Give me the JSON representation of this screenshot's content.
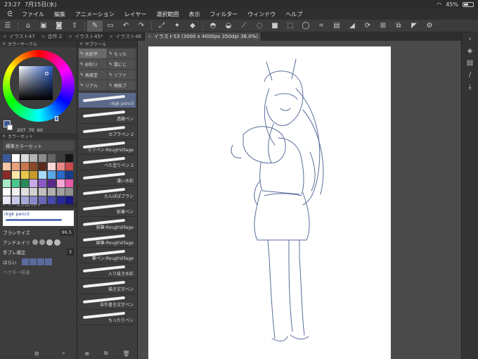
{
  "status": {
    "time": "23:27",
    "date": "7月15日(水)",
    "battery": "45%"
  },
  "menu": [
    "ファイル",
    "編集",
    "アニメーション",
    "レイヤー",
    "選択範囲",
    "表示",
    "フィルター",
    "ウィンドウ",
    "ヘルプ"
  ],
  "tabs": [
    {
      "label": "イラスト47",
      "active": false
    },
    {
      "label": "合作 2",
      "active": false
    },
    {
      "label": "イラスト45*",
      "active": false
    },
    {
      "label": "イラスト48",
      "active": false
    },
    {
      "label": "イラスト53 (3000 x 4000px 350dpi 38.0%)",
      "active": true
    }
  ],
  "panels": {
    "color_circle": "カラーサークル",
    "color_set": "カラーセット",
    "color_set_select": "標準カラーセット",
    "tool_property": "ツールプロパティ",
    "sub_tool": "サブツール"
  },
  "hsv": {
    "h": "207",
    "s": "70",
    "v": "60"
  },
  "tool_props": {
    "preset": "rkgk pencil",
    "brush_size_label": "ブラシサイズ",
    "brush_size_value": "96.5",
    "antialias_label": "アンチエイリ",
    "stabilization_label": "手ブレ補正",
    "stabilization_value": "3",
    "pressure_label": "はらい",
    "vector_label": "ベクター吸着"
  },
  "subtool_tabs": [
    {
      "label": "水彩平",
      "active": true
    },
    {
      "label": "もった",
      "active": false
    },
    {
      "label": "砂利リ",
      "active": false
    },
    {
      "label": "雲にじ",
      "active": false
    },
    {
      "label": "高度塗",
      "active": false
    },
    {
      "label": "ソファ",
      "active": false
    },
    {
      "label": "リアル",
      "active": false
    },
    {
      "label": "梅枝ブ",
      "active": false
    }
  ],
  "brushes": [
    {
      "label": "rkgk pencil",
      "selected": true
    },
    {
      "label": "透鏡ペン",
      "selected": false
    },
    {
      "label": "カブラペン 2",
      "selected": false
    },
    {
      "label": "ミリペン-RoughVillage",
      "selected": false
    },
    {
      "label": "べた塗りペン 2",
      "selected": false
    },
    {
      "label": "濃い水彩",
      "selected": false
    },
    {
      "label": "たんぽぽブラシ",
      "selected": false
    },
    {
      "label": "影筆ペン",
      "selected": false
    },
    {
      "label": "鉛筆-RoughVillage",
      "selected": false
    },
    {
      "label": "線筆-RoughVillage",
      "selected": false
    },
    {
      "label": "筆ペン-RoughVillage",
      "selected": false
    },
    {
      "label": "入り抜き水彩",
      "selected": false
    },
    {
      "label": "描き文字ペン",
      "selected": false
    },
    {
      "label": "自作書き文字ペン",
      "selected": false
    },
    {
      "label": "もったりペン",
      "selected": false
    }
  ],
  "swatches": [
    "#3a5a9a",
    "#ffffff",
    "#dcdcdc",
    "#b4b4b4",
    "#8c8c8c",
    "#646464",
    "#3c3c3c",
    "#141414",
    "#f5c6a5",
    "#e8a07a",
    "#c8764e",
    "#8a4a2a",
    "#5a2a1a",
    "#f8d8d8",
    "#e88a8a",
    "#c84a4a",
    "#8a2a2a",
    "#f8e8a8",
    "#e8c84a",
    "#c89a2a",
    "#a8d8f8",
    "#5aa8e8",
    "#2a6ac8",
    "#1a3a8a",
    "#a8e8c8",
    "#4ac88a",
    "#2a8a5a",
    "#c8a8e8",
    "#8a5ac8",
    "#5a2a8a",
    "#f8a8d8",
    "#e85aa8",
    "#ffffff",
    "#f0f0f0",
    "#e0e0e0",
    "#d0d0d0",
    "#c0c0c0",
    "#b0b0b0",
    "#a0a0a0",
    "#909090",
    "#e8e8f8",
    "#c8c8e8",
    "#a8a8d8",
    "#8888c8",
    "#6868b8",
    "#4848a8",
    "#282898",
    "#181888"
  ]
}
